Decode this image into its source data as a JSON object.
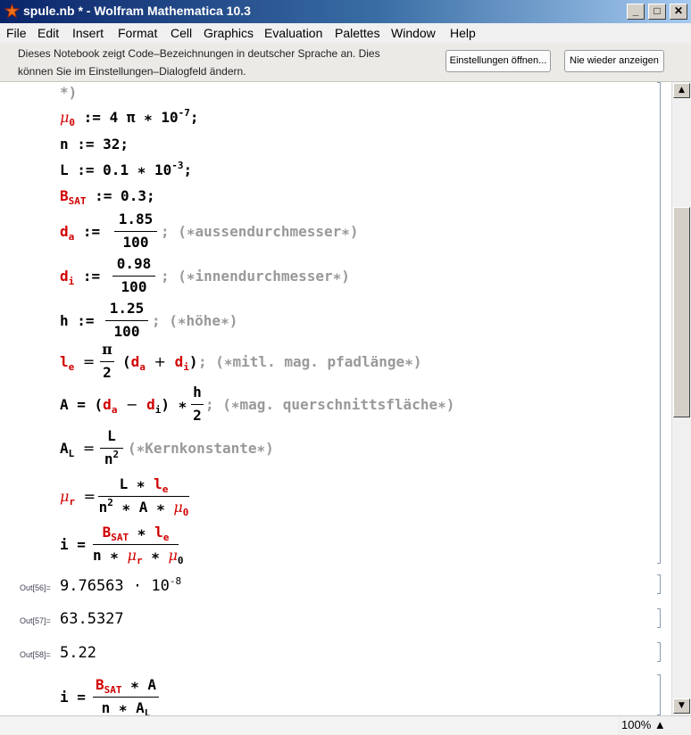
{
  "window": {
    "title": "spule.nb * - Wolfram Mathematica 10.3"
  },
  "menu": [
    "File",
    "Edit",
    "Insert",
    "Format",
    "Cell",
    "Graphics",
    "Evaluation",
    "Palettes",
    "Window",
    "Help"
  ],
  "message": {
    "line1": "Dieses Notebook zeigt Code–Bezeichnungen in deutscher Sprache an. Dies",
    "line2": "können Sie im Einstellungen–Dialogfeld ändern.",
    "btn_settings": "Einstellungen öffnen...",
    "btn_never": "Nie wieder anzeigen"
  },
  "code": {
    "comment_close": "*)",
    "mu0": {
      "sym": "μ",
      "sub": "0",
      "rhs": ":= 4 π ∗ 10",
      "exp": "-7",
      "end": ";"
    },
    "n": {
      "text": "n := 32;"
    },
    "L": {
      "lhs": "L :=",
      "rhs": "0.1 ∗ 10",
      "exp": "-3",
      "end": ";"
    },
    "bsat": {
      "sym": "B",
      "sub": "SAT",
      "rhs": ":= 0.3;"
    },
    "da": {
      "sym": "d",
      "sub": "a",
      "op": ":=",
      "num": "1.85",
      "den": "100",
      "comment": "; (∗aussendurchmesser∗)"
    },
    "di": {
      "sym": "d",
      "sub": "i",
      "op": ":=",
      "num": "0.98",
      "den": "100",
      "comment": "; (∗innendurchmesser∗)"
    },
    "h": {
      "sym": "h",
      "op": ":=",
      "num": "1.25",
      "den": "100",
      "comment": "; (∗höhe∗)"
    },
    "le": {
      "sym": "l",
      "sub": "e",
      "op": "=",
      "num": "π",
      "den": "2",
      "comment": "; (∗mitl. mag. pfadlänge∗)"
    },
    "A": {
      "lhs": "A = (",
      "op": "−",
      "close": ") ∗",
      "num": "h",
      "den": "2",
      "comment": "; (∗mag. querschnittsfläche∗)"
    },
    "AL": {
      "sym": "A",
      "sub": "L",
      "op": "=",
      "num": "L",
      "den": "n",
      "den_exp": "2",
      "comment": "(∗Kernkonstante∗)"
    },
    "mur": {
      "sym": "μ",
      "sub": "r",
      "op": "=",
      "num_mid": "L ∗",
      "den_mid": "∗ A ∗"
    },
    "i1": {
      "sym": "i =",
      "num_mid": "∗",
      "den_left": "n ∗",
      "den_mid": "∗"
    },
    "i2": {
      "sym": "i =",
      "num_mid": "∗ A",
      "den_left": "n ∗ A",
      "den_sub": "L"
    }
  },
  "outputs": [
    {
      "label": "Out[56]=",
      "value": "9.76563 · 10",
      "exp": "-8"
    },
    {
      "label": "Out[57]=",
      "value": "63.5327"
    },
    {
      "label": "Out[58]=",
      "value": "5.22"
    }
  ],
  "status": {
    "zoom": "100%"
  },
  "colors": {
    "symbol": "#d10000",
    "comment": "#999999",
    "title_gradient_start": "#0a246a"
  }
}
